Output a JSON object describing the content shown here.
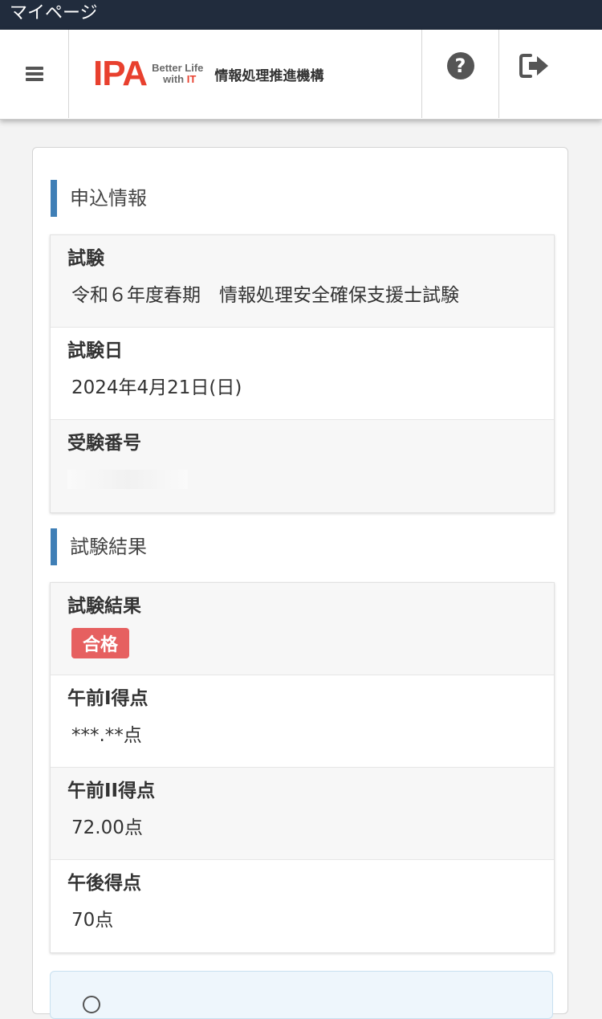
{
  "status_bar": {
    "title": "マイページ"
  },
  "header": {
    "logo_text": "IPA",
    "tagline_line1": "Better Life",
    "tagline_with": "with ",
    "tagline_it": "IT",
    "org_name": "情報処理推進機構"
  },
  "sections": {
    "application": {
      "title": "申込情報",
      "rows": [
        {
          "label": "試験",
          "value": "令和６年度春期　情報処理安全確保支援士試験"
        },
        {
          "label": "試験日",
          "value": "2024年4月21日(日)"
        },
        {
          "label": "受験番号",
          "value": ""
        }
      ]
    },
    "results": {
      "title": "試験結果",
      "result_label": "試験結果",
      "result_badge": "合格",
      "rows": [
        {
          "label": "午前I得点",
          "value": "***.**点"
        },
        {
          "label": "午前II得点",
          "value": "72.00点"
        },
        {
          "label": "午後得点",
          "value": "70点"
        }
      ]
    }
  },
  "colors": {
    "status_bar": "#212c3d",
    "accent_bar": "#3f7fb6",
    "pass_badge": "#e66060",
    "logo_red": "#e8402e"
  },
  "icons": {
    "menu": "hamburger-icon",
    "help": "question-circle-icon",
    "logout": "sign-out-icon",
    "info": "info-icon"
  }
}
